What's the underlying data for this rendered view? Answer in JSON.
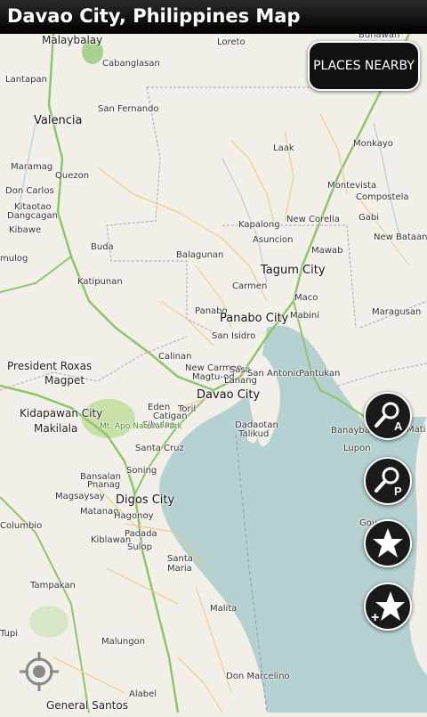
{
  "title": "Davao City, Philippines Map",
  "places_button_label": "PLACES NEARBY",
  "buttons": [
    {
      "name": "search-address-button",
      "icon": "magnifier-a-icon",
      "letter": "A"
    },
    {
      "name": "search-place-button",
      "icon": "magnifier-p-icon",
      "letter": "P"
    },
    {
      "name": "favorites-button",
      "icon": "star-icon"
    },
    {
      "name": "add-favorite-button",
      "icon": "star-plus-icon",
      "symbol": "+"
    }
  ],
  "locate_icon": "crosshair-location-icon",
  "colors": {
    "land": "#f2efe9",
    "water": "#b5d0d0",
    "road_major": "#8dc56c",
    "road_minor": "#f4c57a",
    "boundary": "#b59ab5",
    "park": "#c8e0a8"
  },
  "map_labels": {
    "malaybalay": "Malaybalay",
    "loreto": "Loreto",
    "cabanglasan": "Cabanglasan",
    "lantapan": "Lantapan",
    "san_fernando": "San Fernando",
    "valencia": "Valencia",
    "quezon": "Quezon",
    "maramag": "Maramag",
    "don_carlos": "Don Carlos",
    "kitaotao": "Kitaotao",
    "dangcagan": "Dangcagan",
    "kibawe": "Kibawe",
    "mulog": "mulog",
    "laak": "Laak",
    "monkayo": "Monkayo",
    "montevista": "Montevista",
    "compostela": "Compostela",
    "kapalong": "Kapalong",
    "new_corella": "New Corella",
    "gabi": "Gabi",
    "asuncion": "Asuncion",
    "mawab": "Mawab",
    "new_bataan": "New Bataan",
    "buda": "Buda",
    "balagunan": "Balagunan",
    "tagum_city": "Tagum City",
    "kipatunan": "Katipunan",
    "carmen": "Carmen",
    "maco": "Maco",
    "panabo": "Panabo",
    "panabo_city": "Panabo City",
    "mabini": "Mabini",
    "maragusan": "Maragusan",
    "san_isidro": "San Isidro",
    "calinan": "Calinan",
    "president_roxas": "President Roxas",
    "new_carmen": "New Carmen",
    "sasa": "Sasa",
    "san_antonio": "San Antonio",
    "pantukan": "Pantukan",
    "magpet": "Magpet",
    "magtu_od": "Magtu-od",
    "lanang": "Lanang",
    "davao_city": "Davao City",
    "kidapawan_city": "Kidapawan City",
    "eden": "Eden",
    "toril": "Toril",
    "catigan": "Catigan",
    "dadaotan": "Dadaotan",
    "talikud": "Talikud",
    "sibulan": "Sibulan",
    "makilala": "Makilala",
    "mt_apo": "Mt. Apo Natural Park",
    "banaybanay": "Banaybanay",
    "lupon": "Lupon",
    "mati": "Mati",
    "santa_cruz": "Santa Cruz",
    "soning": "Soning",
    "bansalan": "Bansalan",
    "pnanag": "Pnanag",
    "digos_city": "Digos City",
    "magsaysay": "Magsaysay",
    "matanao": "Matanao",
    "hagonoy": "Hagonoy",
    "columbio": "Columbio",
    "padada": "Padada",
    "kiblawan": "Kiblawan",
    "sulop": "Sulop",
    "govern": "Gov",
    "santa_maria": "Santa Maria",
    "tampakan": "Tampakan",
    "malita": "Malita",
    "tupi": "Tupi",
    "malungon": "Malungon",
    "don_marcelino": "Don Marcelino",
    "alabel": "Alabel",
    "general_santos": "General Santos",
    "buhawan": "Buhawan"
  }
}
